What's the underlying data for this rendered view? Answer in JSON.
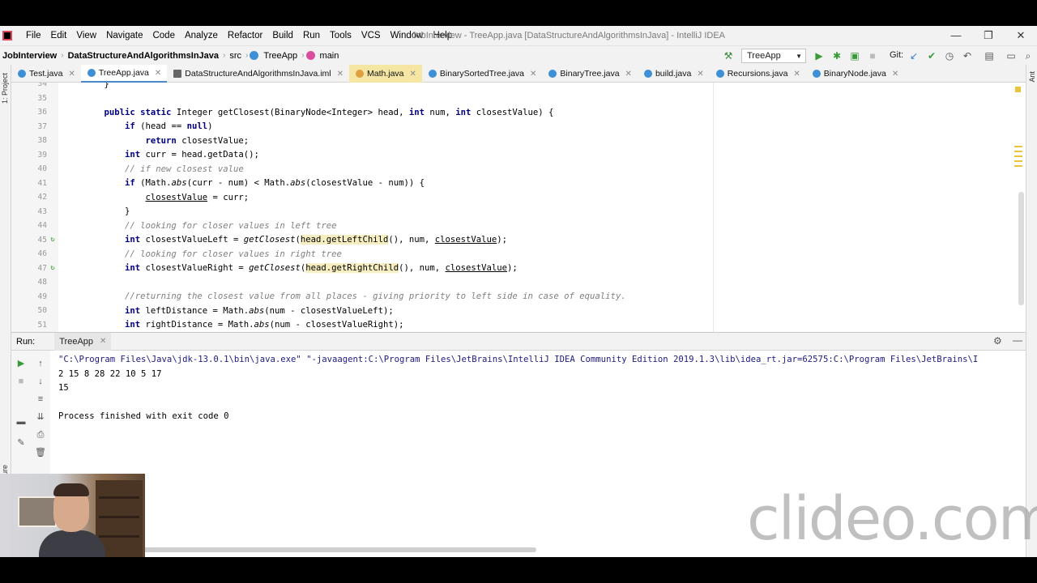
{
  "window": {
    "title": "JobInterview - TreeApp.java [DataStructureAndAlgorithmsInJava] - IntelliJ IDEA",
    "minimize": "—",
    "maximize": "❐",
    "close": "✕"
  },
  "menu": [
    "File",
    "Edit",
    "View",
    "Navigate",
    "Code",
    "Analyze",
    "Refactor",
    "Build",
    "Run",
    "Tools",
    "VCS",
    "Window",
    "Help"
  ],
  "breadcrumb": {
    "project": "JobInterview",
    "module": "DataStructureAndAlgorithmsInJava",
    "src": "src",
    "class": "TreeApp",
    "method": "main"
  },
  "toolbar": {
    "run_config": "TreeApp",
    "git_label": "Git:",
    "icons": [
      "hammer-icon",
      "run-icon",
      "debug-icon",
      "coverage-icon",
      "stop-icon",
      "vcs-update-icon",
      "vcs-commit-icon",
      "history-icon",
      "revert-icon",
      "project-structure-icon",
      "maximize-editor-icon",
      "search-icon"
    ]
  },
  "tabs": [
    {
      "label": "Test.java",
      "color": "#3d8fd6"
    },
    {
      "label": "TreeApp.java",
      "color": "#3d8fd6",
      "active": true
    },
    {
      "label": "DataStructureAndAlgorithmsInJava.iml",
      "color": "#666666"
    },
    {
      "label": "Math.java",
      "color": "#e0a040",
      "highlight": true
    },
    {
      "label": "BinarySortedTree.java",
      "color": "#3d8fd6"
    },
    {
      "label": "BinaryTree.java",
      "color": "#3d8fd6"
    },
    {
      "label": "build.java",
      "color": "#3d8fd6"
    },
    {
      "label": "Recursions.java",
      "color": "#3d8fd6"
    },
    {
      "label": "BinaryNode.java",
      "color": "#3d8fd6"
    }
  ],
  "side_labels": {
    "project": "1: Project",
    "structure": "Z: Structure",
    "ant": "Ant"
  },
  "code": {
    "line_numbers": [
      "34",
      "35",
      "36",
      "37",
      "38",
      "39",
      "40",
      "41",
      "42",
      "43",
      "44",
      "45",
      "46",
      "47",
      "48",
      "49",
      "50",
      "51"
    ],
    "l34": "    }",
    "l36_kw": "public static ",
    "l36_rest": "Integer getClosest(BinaryNode<Integer> head, ",
    "l36_int1": "int",
    "l36_num": " num, ",
    "l36_int2": "int",
    "l36_end": " closestValue) {",
    "l37_kw": "if",
    "l37_rest": " (head == ",
    "l37_null": "null",
    "l37_end": ")",
    "l38_kw": "return",
    "l38_rest": " closestValue;",
    "l39_kw": "int",
    "l39_rest": " curr = head.getData();",
    "l40": "// if new closest value",
    "l41_kw": "if",
    "l41_a": " (Math.",
    "l41_abs1": "abs",
    "l41_b": "(curr - num) < Math.",
    "l41_abs2": "abs",
    "l41_c": "(closestValue - num)) {",
    "l42_var": "closestValue",
    "l42_rest": " = curr;",
    "l43": "}",
    "l44": "// looking for closer values in left tree",
    "l45_kw": "int",
    "l45_a": " closestValueLeft = ",
    "l45_call": "getClosest",
    "l45_b": "(",
    "l45_hl": "head.getLeftChild",
    "l45_c": "(), num, ",
    "l45_var": "closestValue",
    "l45_d": ");",
    "l46": "// looking for closer values in right tree",
    "l47_kw": "int",
    "l47_a": " closestValueRight = ",
    "l47_call": "getClosest",
    "l47_b": "(",
    "l47_hl": "head.getRightChild",
    "l47_c": "(), num, ",
    "l47_var": "closestValue",
    "l47_d": ");",
    "l49": "//returning the closest value from all places - giving priority to left side in case of equality.",
    "l50_kw": "int",
    "l50_a": " leftDistance = Math.",
    "l50_abs": "abs",
    "l50_b": "(num - closestValueLeft);",
    "l51_kw": "int",
    "l51_a": " rightDistance = Math.",
    "l51_abs": "abs",
    "l51_b": "(num - closestValueRight);"
  },
  "run_panel": {
    "title": "Run:",
    "tab": "TreeApp",
    "tool_icons": [
      "rerun-icon",
      "stop-icon",
      "scroll-up-icon",
      "scroll-down-icon",
      "soft-wrap-icon",
      "scroll-to-end-icon",
      "layout-icon",
      "print-icon",
      "pin-icon",
      "trash-icon"
    ],
    "console": {
      "command": "\"C:\\Program Files\\Java\\jdk-13.0.1\\bin\\java.exe\" \"-javaagent:C:\\Program Files\\JetBrains\\IntelliJ IDEA Community Edition 2019.1.3\\lib\\idea_rt.jar=62575:C:\\Program Files\\JetBrains\\I",
      "output1": "2 15 8 28 22 10 5 17",
      "output2": "15",
      "finished": "Process finished with exit code 0"
    }
  },
  "watermark": "clideo.com"
}
